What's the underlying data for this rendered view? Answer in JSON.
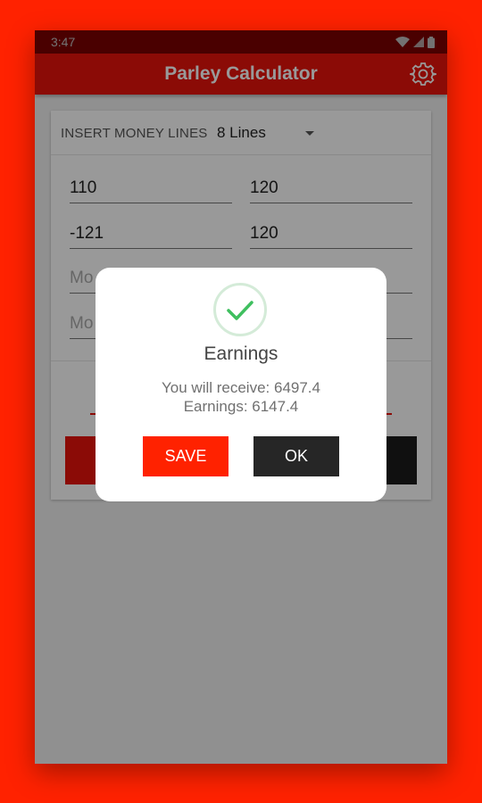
{
  "status_bar": {
    "time": "3:47"
  },
  "app_bar": {
    "title": "Parley Calculator"
  },
  "selector": {
    "label": "INSERT MONEY LINES",
    "value": "8 Lines"
  },
  "fields": {
    "r1_left": "110",
    "r1_right": "120",
    "r2_left": "-121",
    "r2_right": "120",
    "r3_left_placeholder": "Mo",
    "r4_left_placeholder": "Mo"
  },
  "dialog": {
    "title": "Earnings",
    "receive_line": "You will receive: 6497.4",
    "earnings_line": "Earnings: 6147.4",
    "save_label": "SAVE",
    "ok_label": "OK"
  },
  "colors": {
    "background": "#ff2200",
    "app_bar": "#e8130a",
    "status_bar": "#a50000",
    "check": "#3fbf5f",
    "save_button": "#ff2200",
    "ok_button": "#262626"
  }
}
